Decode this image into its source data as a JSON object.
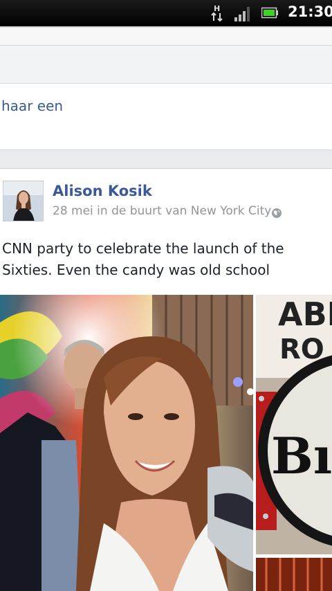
{
  "status_bar": {
    "time": "21:30",
    "network_type": "H",
    "icons": [
      "data-transfer-icon",
      "signal-icon",
      "battery-icon"
    ]
  },
  "previous_post": {
    "text_fragment": "haar een"
  },
  "post": {
    "author": "Alison Kosik",
    "meta": "28 mei in de buurt van New York City",
    "privacy_icon": "globe-icon",
    "text": "CNN party to celebrate the launch of the Sixties. Even the candy was old school"
  },
  "colors": {
    "link": "#3b5998",
    "meta": "#90949c",
    "background": "#e9ebee"
  }
}
